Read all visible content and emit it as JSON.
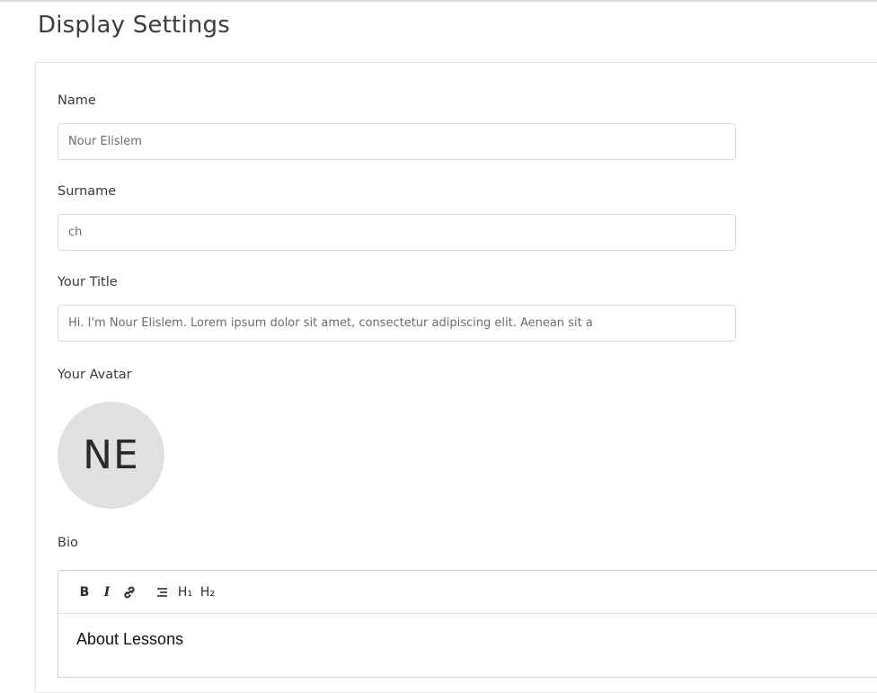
{
  "page": {
    "title": "Display Settings"
  },
  "form": {
    "name": {
      "label": "Name",
      "value": "Nour Elislem"
    },
    "surname": {
      "label": "Surname",
      "value": "ch"
    },
    "title": {
      "label": "Your Title",
      "value": "Hi. I'm Nour Elislem. Lorem ipsum dolor sit amet, consectetur adipiscing elit. Aenean sit a"
    },
    "avatar": {
      "label": "Your Avatar",
      "initials": "NE",
      "background": "#e0e0e0"
    },
    "bio": {
      "label": "Bio",
      "toolbar": {
        "bold": "B",
        "italic": "I",
        "link_icon": "link-icon",
        "list_icon": "list-icon",
        "h1": "H₁",
        "h2": "H₂"
      },
      "content": "About Lessons"
    }
  }
}
